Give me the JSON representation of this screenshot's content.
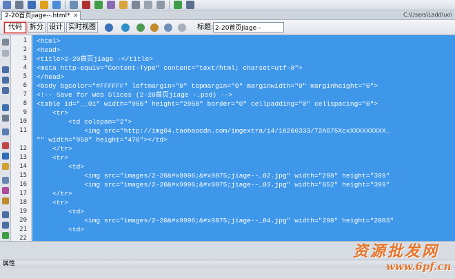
{
  "tab": {
    "title": "2-20首页jiage--.html*",
    "close_glyph": "×"
  },
  "path": "C:\\Users\\Ladd\\uo\\",
  "view": {
    "code_label": "代码",
    "split_label": "拆分",
    "design_label": "设计",
    "live_label": "实时视图",
    "title_label": "标题:",
    "title_value": "2-20首页jiage -"
  },
  "code": {
    "line_numbers": [
      "1",
      "2",
      "3",
      "4",
      "5",
      "6",
      "7",
      "8",
      "9",
      "10",
      "11",
      "",
      "12",
      "13",
      "14",
      "15",
      "16",
      "17",
      "18",
      "19",
      "20",
      "21",
      "22"
    ],
    "lines": [
      "<html>",
      "<head>",
      "<title>2-20首页jiage -</title>",
      "<meta http-equiv=\"Content-Type\" content=\"text/html; charset=utf-8\">",
      "</head>",
      "<body bgcolor=\"#FFFFFF\" leftmargin=\"0\" topmargin=\"0\" marginwidth=\"0\" marginheight=\"0\">",
      "<!-- Save for Web Slices (2-20首页jiage -.psd) -->",
      "<table id=\"__01\" width=\"950\" height=\"2958\" border=\"0\" cellpadding=\"0\" cellspacing=\"0\">",
      "    <tr>",
      "        <td colspan=\"2\">",
      "            <img src=\"http://img04.taobaocdn.com/imgextra/i4/16206333/T2AG75XcxXXXXXXXXX_",
      "\"\" width=\"950\" height=\"476\"></td>",
      "    </tr>",
      "    <tr>",
      "        <td>",
      "            <img src=\"images/2-20&#x9996;&#x9875;jiage--_02.jpg\" width=\"298\" height=\"399\"",
      "            <img src=\"images/2-20&#x9996;&#x9875;jiage--_03.jpg\" width=\"652\" height=\"399\"",
      "    </tr>",
      "    <tr>",
      "        <td>",
      "            <img src=\"images/2-20&#x9996;&#x9875;jiage--_04.jpg\" width=\"298\" height=\"2083\"",
      "        <td>"
    ]
  },
  "properties": {
    "label": "属性"
  },
  "watermark": {
    "text": "资源批发网",
    "url": "www.6pf.cn"
  },
  "colors": {
    "selection": "#3f97ea",
    "watermark": "#e8742b",
    "active_border": "#d12b2b"
  }
}
